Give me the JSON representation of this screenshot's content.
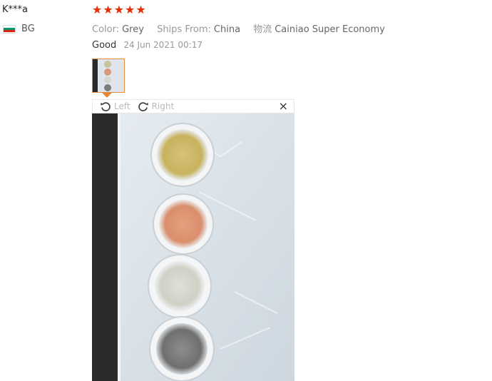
{
  "review": {
    "user_name": "K***a",
    "country_code": "BG",
    "rating": 5,
    "star_glyph": "★",
    "star_color": "#e62e04",
    "attributes": [
      {
        "key": "Color:",
        "value": "Grey"
      },
      {
        "key": "Ships From:",
        "value": "China"
      },
      {
        "key": "物流",
        "value": "Cainiao Super Economy"
      }
    ],
    "feedback_text": "Good",
    "date": "24 Jun 2021 00:17"
  },
  "viewer": {
    "rotate_left_label": "Left",
    "rotate_right_label": "Right",
    "close_glyph": "×",
    "accent_color": "#e38a3a"
  },
  "icons": {
    "rotate_left": "rotate-left-icon",
    "rotate_right": "rotate-right-icon",
    "close": "close-icon",
    "flag": "bulgaria-flag-icon"
  }
}
